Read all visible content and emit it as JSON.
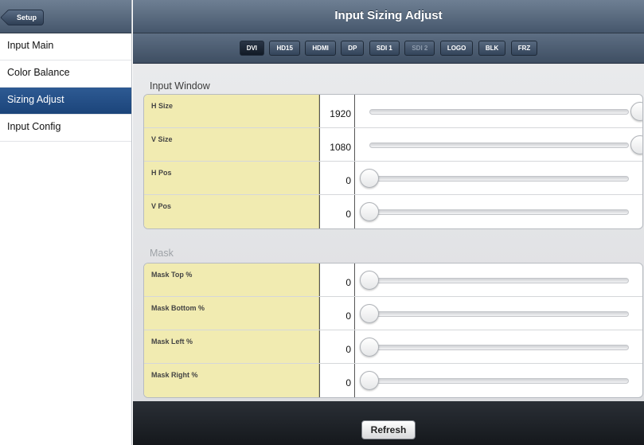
{
  "sidebar": {
    "back_label": "Setup",
    "items": [
      {
        "label": "Input Main",
        "active": false
      },
      {
        "label": "Color Balance",
        "active": false
      },
      {
        "label": "Sizing Adjust",
        "active": true
      },
      {
        "label": "Input Config",
        "active": false
      }
    ]
  },
  "header": {
    "title": "Input Sizing Adjust"
  },
  "input_tabs": [
    {
      "label": "DVI",
      "state": "selected"
    },
    {
      "label": "HD15",
      "state": "normal"
    },
    {
      "label": "HDMI",
      "state": "normal"
    },
    {
      "label": "DP",
      "state": "normal"
    },
    {
      "label": "SDI 1",
      "state": "normal"
    },
    {
      "label": "SDI 2",
      "state": "disabled"
    },
    {
      "label": "LOGO",
      "state": "normal"
    },
    {
      "label": "BLK",
      "state": "normal"
    },
    {
      "label": "FRZ",
      "state": "normal"
    }
  ],
  "input_window": {
    "title": "Input Window",
    "rows": [
      {
        "label": "H Size",
        "value": "1920",
        "slider_fraction": 1.0
      },
      {
        "label": "V Size",
        "value": "1080",
        "slider_fraction": 1.0
      },
      {
        "label": "H Pos",
        "value": "0",
        "slider_fraction": 0.0
      },
      {
        "label": "V Pos",
        "value": "0",
        "slider_fraction": 0.0
      }
    ]
  },
  "mask": {
    "title": "Mask",
    "rows": [
      {
        "label": "Mask Top %",
        "value": "0",
        "slider_fraction": 0.0
      },
      {
        "label": "Mask Bottom %",
        "value": "0",
        "slider_fraction": 0.0
      },
      {
        "label": "Mask Left %",
        "value": "0",
        "slider_fraction": 0.0
      },
      {
        "label": "Mask Right %",
        "value": "0",
        "slider_fraction": 0.0
      }
    ]
  },
  "footer": {
    "refresh_label": "Refresh"
  },
  "colors": {
    "header_gradient_top": "#6e7f93",
    "active_item": "#1b447a",
    "label_background": "#f1ebb1",
    "footer_background": "#1b1e22"
  }
}
